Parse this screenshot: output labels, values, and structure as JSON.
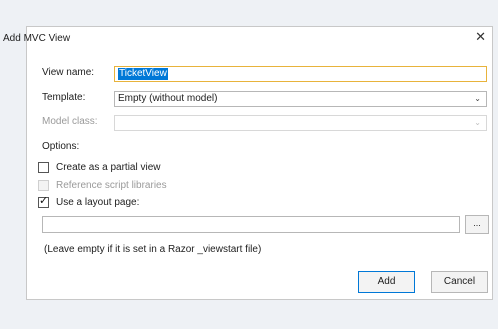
{
  "dialog": {
    "title": "Add MVC View",
    "close_icon": "close-icon"
  },
  "form": {
    "view_name_label": "View name:",
    "view_name_value": "TicketView",
    "template_label": "Template:",
    "template_value": "Empty (without model)",
    "model_class_label": "Model class:",
    "model_class_value": "",
    "options_label": "Options:"
  },
  "options": {
    "partial_view": {
      "label": "Create as a partial view",
      "checked": false,
      "enabled": true
    },
    "reference_scripts": {
      "label": "Reference script libraries",
      "checked": false,
      "enabled": false
    },
    "use_layout": {
      "label": "Use a layout page:",
      "checked": true,
      "enabled": true
    }
  },
  "layout": {
    "path_value": "",
    "browse_label": "...",
    "hint": "(Leave empty if it is set in a Razor _viewstart file)"
  },
  "buttons": {
    "add": "Add",
    "cancel": "Cancel"
  },
  "colors": {
    "selection": "#0078d7",
    "focus_border": "#e8b33b",
    "background": "#eef1f5"
  }
}
